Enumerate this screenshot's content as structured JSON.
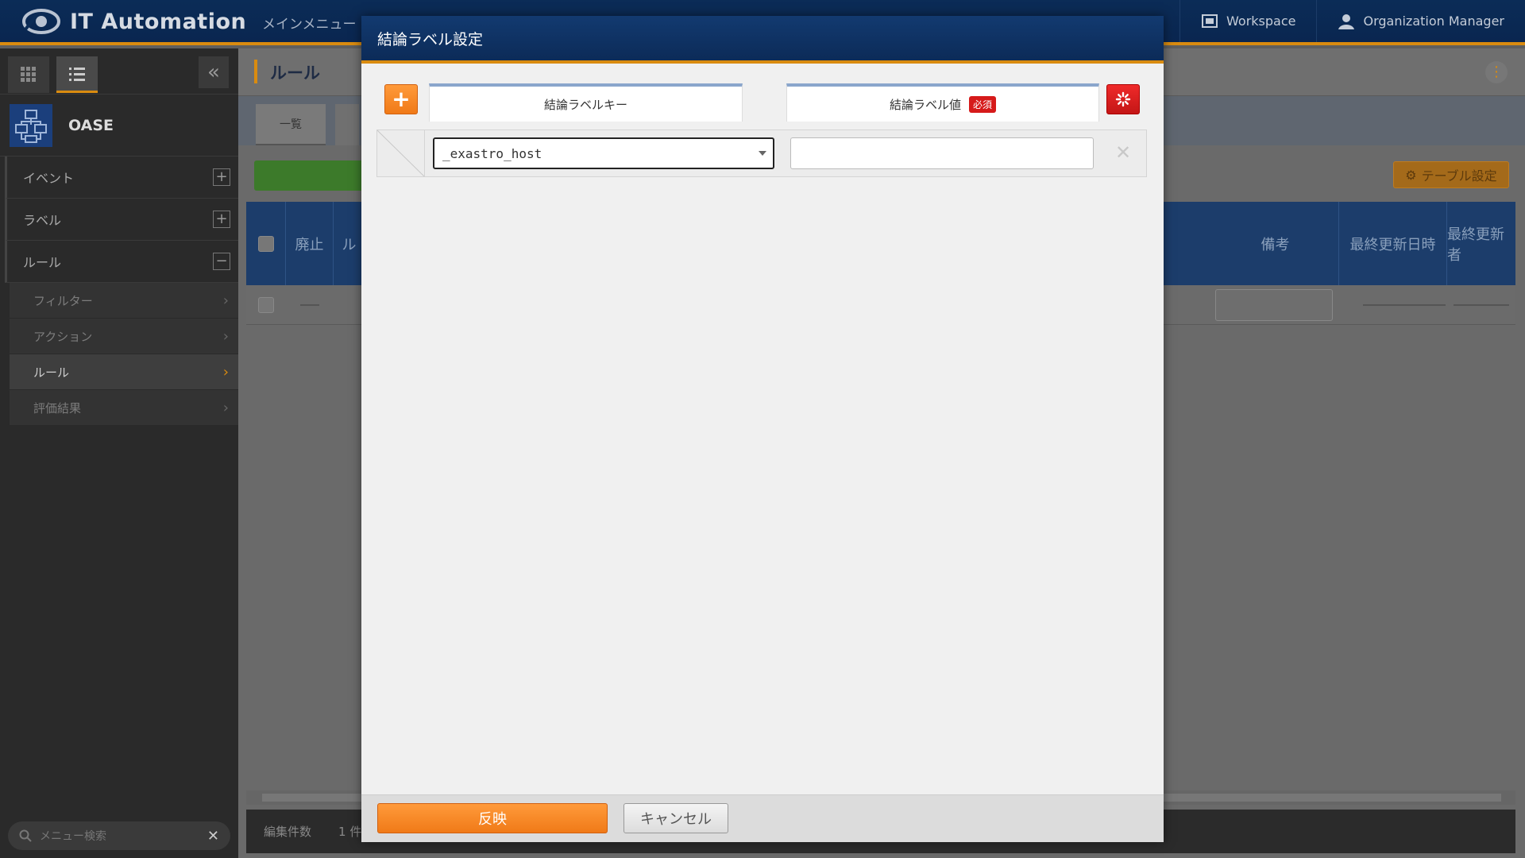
{
  "header": {
    "app_title": "IT Automation",
    "breadcrumb": "メインメニュー",
    "workspace_label": "Workspace",
    "org_label": "Organization Manager"
  },
  "sidebar": {
    "menu_title": "OASE",
    "groups": [
      {
        "label": "イベント",
        "toggle": "+"
      },
      {
        "label": "ラベル",
        "toggle": "+"
      },
      {
        "label": "ルール",
        "toggle": "−"
      }
    ],
    "subitems": [
      {
        "label": "フィルター"
      },
      {
        "label": "アクション"
      },
      {
        "label": "ルール"
      },
      {
        "label": "評価結果"
      }
    ],
    "search_placeholder": "メニュー検索"
  },
  "main": {
    "page_title": "ルール",
    "tab_list": "一覧",
    "table_settings": "テーブル設定",
    "columns": [
      "廃止",
      "ル",
      "備考",
      "最終更新日時",
      "最終更新者"
    ],
    "footer_label": "編集件数",
    "footer_count": "1 件"
  },
  "modal": {
    "title": "結論ラベル設定",
    "col_key": "結論ラベルキー",
    "col_value": "結論ラベル値",
    "required_badge": "必須",
    "row": {
      "key_value": "_exastro_host",
      "value_value": ""
    },
    "apply_label": "反映",
    "cancel_label": "キャンセル"
  },
  "colors": {
    "accent": "#f07a18",
    "header_navy": "#0c2b58",
    "danger": "#c41616"
  }
}
